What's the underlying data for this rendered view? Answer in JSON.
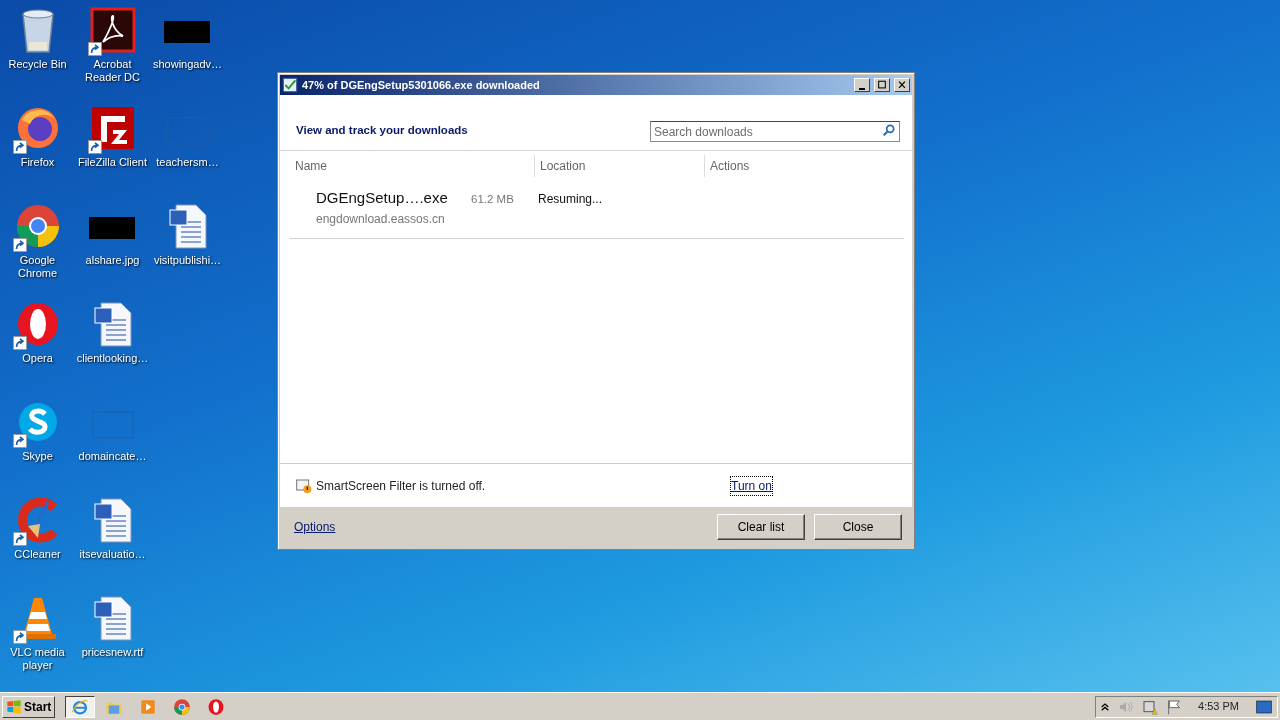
{
  "desktop_icons": [
    {
      "label": "Recycle Bin",
      "kind": "recycle-bin",
      "shortcut": false
    },
    {
      "label": "Firefox",
      "kind": "firefox",
      "shortcut": true
    },
    {
      "label": "Google Chrome",
      "kind": "chrome",
      "shortcut": true
    },
    {
      "label": "Opera",
      "kind": "opera",
      "shortcut": true
    },
    {
      "label": "Skype",
      "kind": "skype",
      "shortcut": true
    },
    {
      "label": "CCleaner",
      "kind": "ccleaner",
      "shortcut": true
    },
    {
      "label": "VLC media player",
      "kind": "vlc",
      "shortcut": true
    },
    {
      "label": "Acrobat Reader DC",
      "kind": "acrobat",
      "shortcut": true
    },
    {
      "label": "FileZilla Client",
      "kind": "filezilla",
      "shortcut": true
    },
    {
      "label": "alshare.jpg",
      "kind": "image",
      "shortcut": false
    },
    {
      "label": "clientlooking…",
      "kind": "word",
      "shortcut": false
    },
    {
      "label": "domaincate…",
      "kind": "blank",
      "shortcut": false
    },
    {
      "label": "itsevaluatio…",
      "kind": "word",
      "shortcut": false
    },
    {
      "label": "pricesnew.rtf",
      "kind": "word",
      "shortcut": false
    },
    {
      "label": "showingadv…",
      "kind": "image",
      "shortcut": false
    },
    {
      "label": "teachersm…",
      "kind": "blank",
      "shortcut": false
    },
    {
      "label": "visitpublishi…",
      "kind": "word",
      "shortcut": false
    }
  ],
  "window": {
    "title": "47% of DGEngSetup5301066.exe downloaded",
    "heading": "View and track your downloads",
    "search": {
      "placeholder": "Search downloads"
    },
    "columns": [
      "Name",
      "Location",
      "Actions"
    ],
    "downloads": [
      {
        "name": "DGEngSetup….exe",
        "size": "61.2 MB",
        "source": "engdownload.eassos.cn",
        "status": "Resuming..."
      }
    ],
    "smartscreen": {
      "message": "SmartScreen Filter is turned off.",
      "link": "Turn on"
    },
    "options": "Options",
    "buttons": [
      "Clear list",
      "Close"
    ]
  },
  "taskbar": {
    "start": "Start",
    "apps": [
      {
        "kind": "ie",
        "selected": true
      },
      {
        "kind": "explorer",
        "selected": false
      },
      {
        "kind": "media",
        "selected": false
      },
      {
        "kind": "chrome",
        "selected": false
      },
      {
        "kind": "opera",
        "selected": false
      }
    ],
    "time": "4:53 PM"
  }
}
